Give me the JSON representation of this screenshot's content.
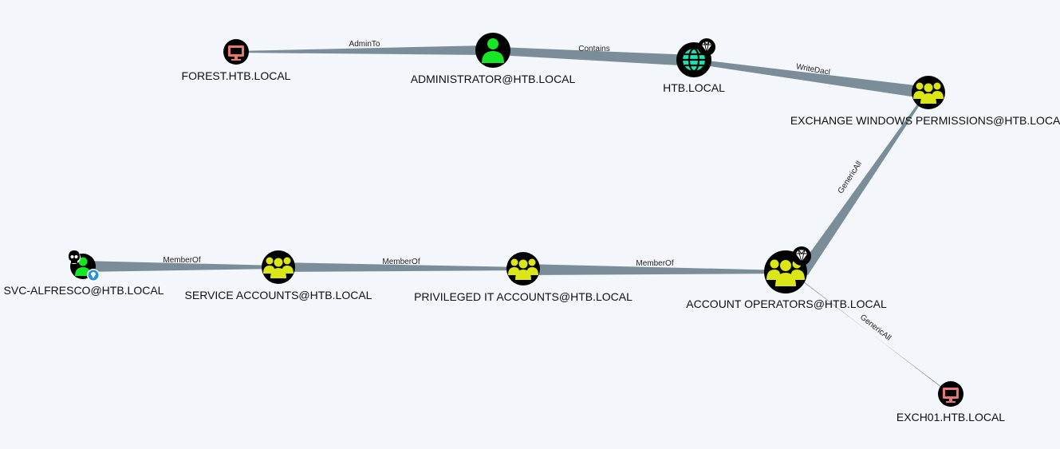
{
  "colors": {
    "background": "#f3f6fa",
    "edge": "#7a8d99",
    "node_ring": "#000000",
    "user": "#17e625",
    "group": "#dbe617",
    "computer": "#e67873",
    "domain": "#17e6b9",
    "owned_badge": "#2a8fd6"
  },
  "nodes": {
    "forest": {
      "label": "FOREST.HTB.LOCAL",
      "kind": "computer",
      "icon": "monitor-icon"
    },
    "administrator": {
      "label": "ADMINISTRATOR@HTB.LOCAL",
      "kind": "user",
      "icon": "user-icon"
    },
    "htb": {
      "label": "HTB.LOCAL",
      "kind": "domain",
      "icon": "globe-icon",
      "badge": "diamond-icon"
    },
    "exchange": {
      "label": "EXCHANGE WINDOWS PERMISSIONS@HTB.LOCAL",
      "kind": "group",
      "icon": "group-icon"
    },
    "svc": {
      "label": "SVC-ALFRESCO@HTB.LOCAL",
      "kind": "user",
      "icon": "user-icon",
      "badges": [
        "skull-icon",
        "location-pin-icon"
      ]
    },
    "service": {
      "label": "SERVICE ACCOUNTS@HTB.LOCAL",
      "kind": "group",
      "icon": "group-icon"
    },
    "privileged": {
      "label": "PRIVILEGED IT ACCOUNTS@HTB.LOCAL",
      "kind": "group",
      "icon": "group-icon"
    },
    "account": {
      "label": "ACCOUNT OPERATORS@HTB.LOCAL",
      "kind": "group",
      "icon": "group-icon",
      "badge": "diamond-icon"
    },
    "exch01": {
      "label": "EXCH01.HTB.LOCAL",
      "kind": "computer",
      "icon": "monitor-icon"
    }
  },
  "edges": {
    "admin_to": {
      "label": "AdminTo",
      "from": "administrator",
      "to": "forest"
    },
    "contains": {
      "label": "Contains",
      "from": "administrator",
      "to": "htb"
    },
    "write_dacl": {
      "label": "WriteDacl",
      "from": "htb",
      "to": "exchange"
    },
    "generic_all_1": {
      "label": "GenericAll",
      "from": "account",
      "to": "exchange"
    },
    "member_of_1": {
      "label": "MemberOf",
      "from": "svc",
      "to": "service"
    },
    "member_of_2": {
      "label": "MemberOf",
      "from": "service",
      "to": "privileged"
    },
    "member_of_3": {
      "label": "MemberOf",
      "from": "privileged",
      "to": "account"
    },
    "generic_all_2": {
      "label": "GenericAll",
      "from": "account",
      "to": "exch01"
    }
  }
}
